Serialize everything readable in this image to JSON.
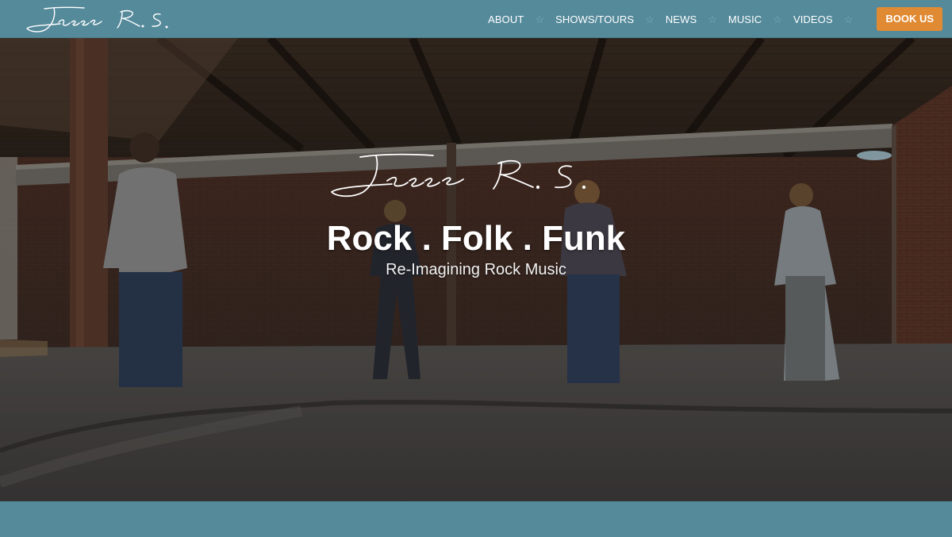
{
  "brand": {
    "logo_text": "Jesse R.S."
  },
  "nav": {
    "items": [
      {
        "label": "ABOUT"
      },
      {
        "label": "SHOWS/TOURS"
      },
      {
        "label": "NEWS"
      },
      {
        "label": "MUSIC"
      },
      {
        "label": "VIDEOS"
      }
    ],
    "separator_icon": "star-outline-icon",
    "book_label": "BOOK US"
  },
  "hero": {
    "logo_text": "Jesse R.S.",
    "title": "Rock . Folk . Funk",
    "subtitle": "Re-Imagining Rock Music"
  },
  "colors": {
    "header_bg": "#558a9b",
    "accent": "#e08a33",
    "text": "#ffffff"
  }
}
